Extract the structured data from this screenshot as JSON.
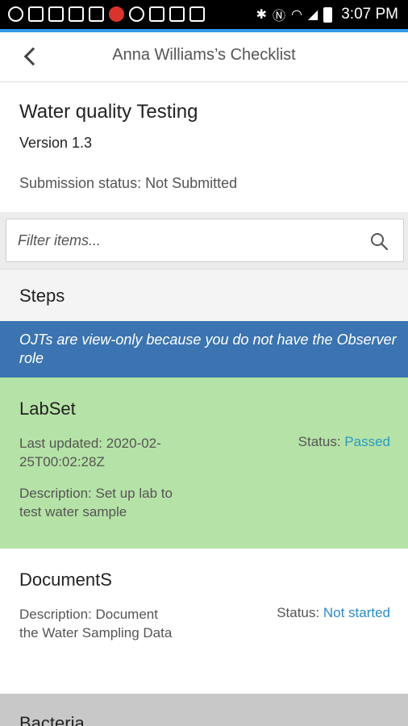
{
  "status_bar": {
    "time": "3:07 PM"
  },
  "header": {
    "title": "Anna Williams’s Checklist"
  },
  "checklist": {
    "title": "Water quality Testing",
    "version": "Version 1.3",
    "submission_status": "Submission status: Not Submitted"
  },
  "filter": {
    "placeholder": "Filter items..."
  },
  "steps_section": {
    "title": "Steps",
    "banner": "OJTs are view-only because you do not have the Observer role"
  },
  "steps": [
    {
      "name": "LabSet",
      "last_updated_line1": "Last updated: 2020-02-",
      "last_updated_line2": "25T00:02:28Z",
      "description_line1": "Description: Set up lab to",
      "description_line2": "test water sample",
      "status_label": "Status:",
      "status_value": "Passed"
    },
    {
      "name": "DocumentS",
      "description_line1": "Description: Document",
      "description_line2": "the Water Sampling Data",
      "status_label": "Status:",
      "status_value": "Not started"
    }
  ],
  "next_section": {
    "title": "Bacteria"
  },
  "colors": {
    "accent": "#2f9be6",
    "banner": "#3b74b0",
    "passed_bg": "#b5e2a6",
    "status_link": "#2a9ac4"
  }
}
